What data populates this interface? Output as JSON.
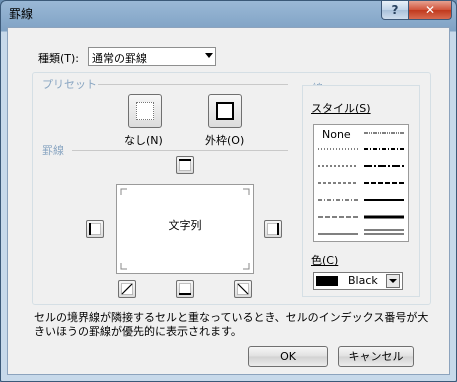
{
  "window": {
    "title": "罫線",
    "help_label": "?",
    "close_label": "✕"
  },
  "kind": {
    "label": "種類(T):",
    "selected": "通常の罫線"
  },
  "preset": {
    "section_label": "プリセット",
    "none_label": "なし(N)",
    "outline_label": "外枠(O)"
  },
  "border": {
    "section_label": "罫線",
    "preview_text": "文字列"
  },
  "line": {
    "section_label": "線",
    "style_label": "スタイル(S)",
    "style_none": "None",
    "color_label": "色(C)",
    "color_value": "Black",
    "color_hex": "#000000"
  },
  "note": "セルの境界線が隣接するセルと重なっているとき、セルのインデックス番号が大きいほうの罫線が優先的に表示されます。",
  "buttons": {
    "ok": "OK",
    "cancel": "キャンセル"
  }
}
